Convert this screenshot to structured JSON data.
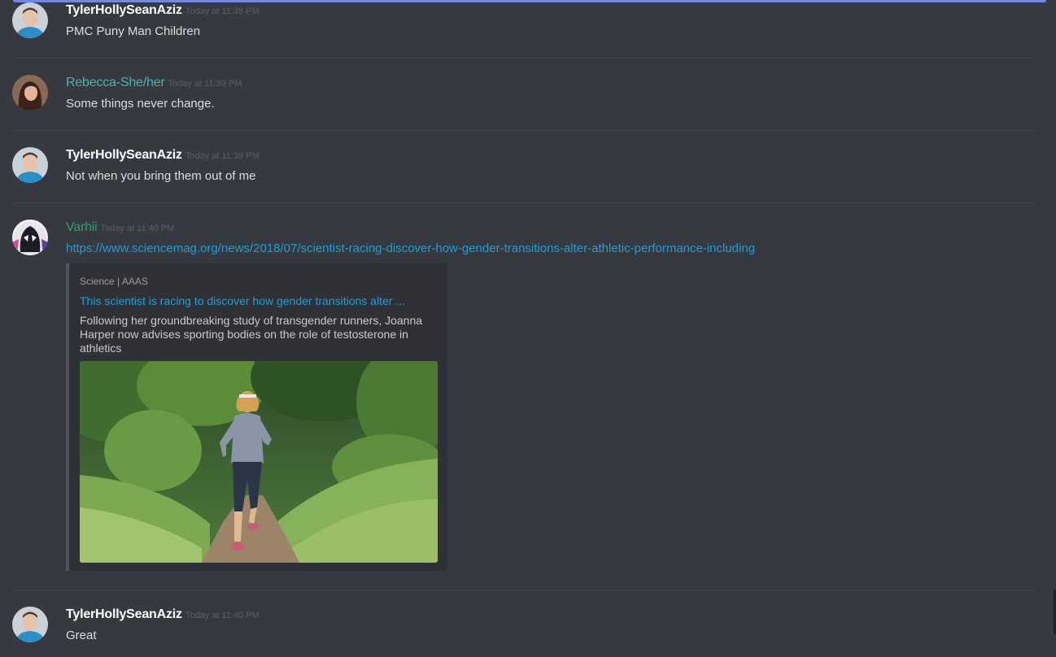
{
  "messages": [
    {
      "username": "TylerHollySeanAziz",
      "timestamp": "Today at 11:39 PM",
      "text": "PMC Puny Man Children"
    },
    {
      "username": "Rebecca-She/her",
      "timestamp": "Today at 11:39 PM",
      "text": "Some things never change."
    },
    {
      "username": "TylerHollySeanAziz",
      "timestamp": "Today at 11:39 PM",
      "text": "Not when you bring them out of me"
    },
    {
      "username": "Varhii",
      "timestamp": "Today at 11:40 PM",
      "link": "https://www.sciencemag.org/news/2018/07/scientist-racing-discover-how-gender-transitions-alter-athletic-performance-including",
      "embed": {
        "provider": "Science | AAAS",
        "title": "This scientist is racing to discover how gender transitions alter ...",
        "description": "Following her groundbreaking study of transgender runners, Joanna Harper now advises sporting bodies on the role of testosterone in athletics"
      }
    },
    {
      "username": "TylerHollySeanAziz",
      "timestamp": "Today at 11:40 PM",
      "text": "Great"
    }
  ],
  "colors": {
    "background": "#36393f",
    "link": "#1e9ed9",
    "username_rebecca": "#4bb3b0",
    "username_varhii": "#2e9e6d",
    "accent_bar": "#7289da"
  },
  "icons": {
    "avatar_tyler": "man-avatar-icon",
    "avatar_rebecca": "woman-avatar-icon",
    "avatar_varhii": "spider-gwen-avatar-icon",
    "embed_image": "runner-on-forest-trail-photo"
  }
}
